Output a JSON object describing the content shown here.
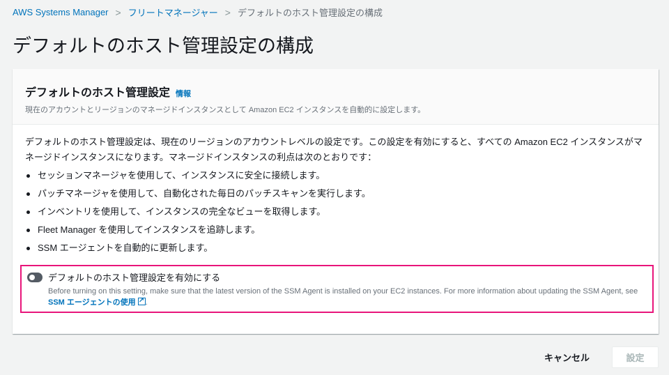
{
  "breadcrumb": {
    "items": [
      "AWS Systems Manager",
      "フリートマネージャー"
    ],
    "current": "デフォルトのホスト管理設定の構成"
  },
  "page_title": "デフォルトのホスト管理設定の構成",
  "card": {
    "title": "デフォルトのホスト管理設定",
    "info": "情報",
    "subtitle": "現在のアカウントとリージョンのマネージドインスタンスとして Amazon EC2 インスタンスを自動的に設定します。",
    "intro": "デフォルトのホスト管理設定は、現在のリージョンのアカウントレベルの設定です。この設定を有効にすると、すべての Amazon EC2 インスタンスがマネージドインスタンスになります。マネージドインスタンスの利点は次のとおりです：",
    "bullets": [
      "セッションマネージャを使用して、インスタンスに安全に接続します。",
      "パッチマネージャを使用して、自動化された毎日のパッチスキャンを実行します。",
      "インベントリを使用して、インスタンスの完全なビューを取得します。",
      "Fleet Manager を使用してインスタンスを追跡します。",
      "SSM エージェントを自動的に更新します。"
    ],
    "toggle": {
      "label": "デフォルトのホスト管理設定を有効にする",
      "checked": false,
      "desc": "Before turning on this setting, make sure that the latest version of the SSM Agent is installed on your EC2 instances. For more information about updating the SSM Agent, see ",
      "link": "SSM エージェントの使用",
      "end": "."
    }
  },
  "actions": {
    "cancel": "キャンセル",
    "submit": "設定"
  }
}
